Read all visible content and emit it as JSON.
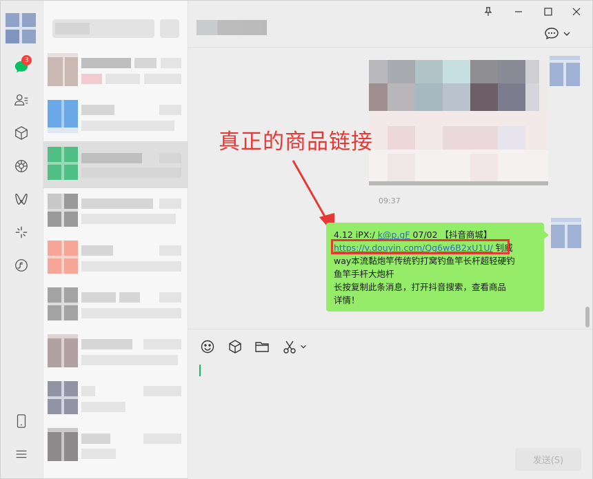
{
  "sidebar": {
    "unread_badge": "3",
    "icons": [
      "chat-icon",
      "contacts-icon",
      "favorites-icon",
      "moments-icon",
      "channels-icon",
      "mini-programs-icon",
      "search-icon",
      "phone-icon",
      "menu-icon"
    ]
  },
  "chat": {
    "timestamp": "09:37",
    "message": {
      "line1_prefix": "4.12 iPX:/ ",
      "line1_link": "k@p.gF",
      "line1_suffix": " 07/02 【抖音商城】",
      "url": "https://v.douyin.com/Qg6w6B2xU1U/",
      "after_url": " 钊威",
      "line3": "way本流黏炮竿传统钓打窝钓鱼竿长杆超轻硬钓",
      "line4": "鱼竿手杆大炮杆",
      "line5": "长按复制此条消息，打开抖音搜索，查看商品",
      "line6": "详情！"
    },
    "annotation": "真正的商品链接"
  },
  "input": {
    "send_label": "发送(S)"
  },
  "colors": {
    "accent": "#07c160",
    "bubble": "#95ec69",
    "annotation_red": "#e53935",
    "badge_red": "#f43f3b"
  }
}
